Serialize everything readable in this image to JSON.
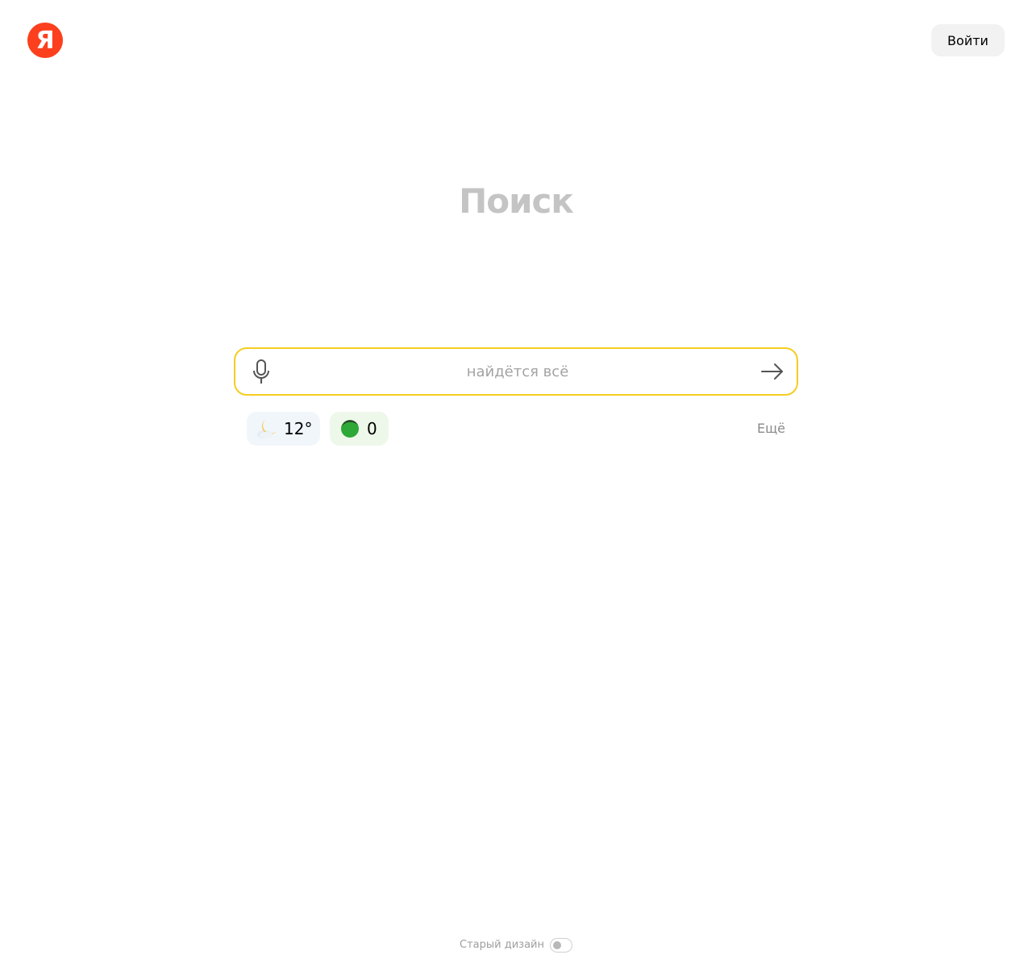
{
  "header": {
    "logo_letter": "Я",
    "login_label": "Войти"
  },
  "main": {
    "title": "Поиск",
    "search": {
      "placeholder": "найдётся всё",
      "value": ""
    }
  },
  "widgets": {
    "weather": {
      "icon": "moon-cloud-icon",
      "value": "12°"
    },
    "traffic": {
      "icon": "traffic-light-icon",
      "value": "0"
    },
    "more_label": "Ещё"
  },
  "footer": {
    "old_design_label": "Старый дизайн",
    "old_design_enabled": false
  },
  "colors": {
    "brand": "#fc3f1d",
    "search_border": "#f5cd21",
    "traffic_green": "#2ea836"
  }
}
